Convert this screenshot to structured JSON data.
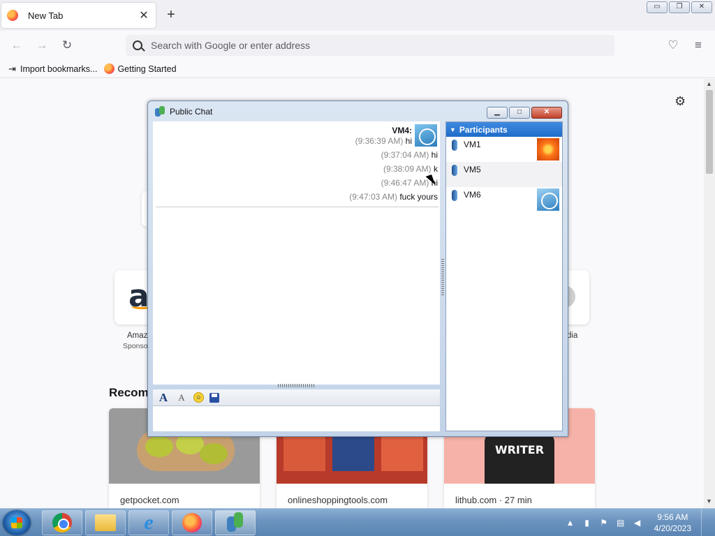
{
  "browser": {
    "tab_title": "New Tab",
    "tab_close": "✕",
    "new_tab": "+",
    "window_buttons": {
      "minimize": "▭",
      "restore": "❐",
      "close": "✕"
    },
    "nav": {
      "back": "←",
      "forward": "→",
      "reload": "↻"
    },
    "url_placeholder": "Search with Google or enter address",
    "bookmarks": [
      {
        "label": "Import bookmarks..."
      },
      {
        "label": "Getting Started"
      }
    ]
  },
  "newtab": {
    "top_sites": [
      {
        "label": "Amaz",
        "sublabel": "Sponso"
      },
      {
        "label": "dia"
      }
    ],
    "recommended_heading": "Recomm",
    "cards": [
      {
        "source": "getpocket.com"
      },
      {
        "source": "onlineshoppingtools.com"
      },
      {
        "source": "lithub.com · 27 min",
        "image_text": "WRITER"
      }
    ]
  },
  "chat": {
    "title": "Public Chat",
    "sender": "VM4:",
    "messages": [
      {
        "time": "(9:36:39 AM)",
        "text": "hi"
      },
      {
        "time": "(9:37:04 AM)",
        "text": "hi"
      },
      {
        "time": "(9:38:09 AM)",
        "text": "k"
      },
      {
        "time": "(9:46:47 AM)",
        "text": "hi"
      },
      {
        "time": "(9:47:03 AM)",
        "text": "fuck yours"
      }
    ],
    "participants_header": "Participants",
    "participants": [
      {
        "name": "VM1",
        "avatar": "flower"
      },
      {
        "name": "VM5",
        "avatar": ""
      },
      {
        "name": "VM6",
        "avatar": "ferris-wheel"
      }
    ],
    "toolbar": {
      "font": "A",
      "font_color": "A"
    }
  },
  "taskbar": {
    "clock_time": "9:56 AM",
    "clock_date": "4/20/2023"
  }
}
